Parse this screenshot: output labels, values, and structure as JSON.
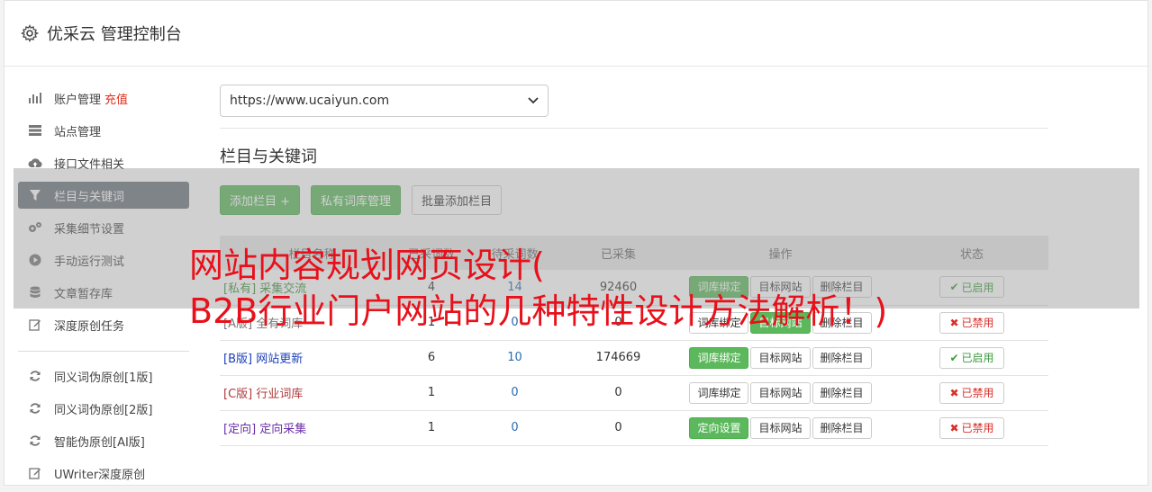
{
  "header": {
    "title": "优采云 管理控制台"
  },
  "sidebar": {
    "items": [
      {
        "label": "账户管理",
        "extra": "充值",
        "icon": "bar-chart-icon"
      },
      {
        "label": "站点管理",
        "icon": "server-icon"
      },
      {
        "label": "接口文件相关",
        "icon": "cloud-upload-icon"
      },
      {
        "label": "栏目与关键词",
        "icon": "filter-icon",
        "active": true
      },
      {
        "label": "采集细节设置",
        "icon": "gears-icon"
      },
      {
        "label": "手动运行测试",
        "icon": "play-icon"
      },
      {
        "label": "文章暂存库",
        "icon": "database-icon"
      },
      {
        "label": "深度原创任务",
        "icon": "edit-icon"
      }
    ],
    "items2": [
      {
        "label": "同义词伪原创[1版]",
        "icon": "refresh-icon"
      },
      {
        "label": "同义词伪原创[2版]",
        "icon": "refresh-icon"
      },
      {
        "label": "智能伪原创[AI版]",
        "icon": "refresh-icon"
      },
      {
        "label": "UWriter深度原创",
        "icon": "edit-icon"
      }
    ]
  },
  "main": {
    "site_select": "https://www.ucaiyun.com",
    "section_title": "栏目与关键词",
    "buttons": {
      "add_column": "添加栏目 +",
      "private_lib": "私有词库管理",
      "batch_add": "批量添加栏目"
    },
    "table": {
      "headers": [
        "栏目名称",
        "已采词数",
        "待采词数",
        "已采集",
        "操作",
        "状态"
      ],
      "rows": [
        {
          "tag": "[私有]",
          "name": "采集交流",
          "a": "4",
          "b": "14",
          "c": "92460",
          "op1": "词库绑定",
          "op2": "目标网站",
          "op3": "删除栏目",
          "status": "已启用"
        },
        {
          "tag": "[A版]",
          "name": "全有词库",
          "a": "1",
          "b": "0",
          "c": "0",
          "op1": "词库绑定",
          "op2": "目标网站",
          "op3": "删除栏目",
          "status": "已禁用"
        },
        {
          "tag": "[B版]",
          "name": "网站更新",
          "a": "6",
          "b": "10",
          "c": "174669",
          "op1": "词库绑定",
          "op2": "目标网站",
          "op3": "删除栏目",
          "status": "已启用"
        },
        {
          "tag": "[C版]",
          "name": "行业词库",
          "a": "1",
          "b": "0",
          "c": "0",
          "op1": "词库绑定",
          "op2": "目标网站",
          "op3": "删除栏目",
          "status": "已禁用"
        },
        {
          "tag": "[定向]",
          "name": "定向采集",
          "a": "1",
          "b": "0",
          "c": "0",
          "op1": "定向设置",
          "op2": "目标网站",
          "op3": "删除栏目",
          "status": "已禁用"
        }
      ]
    }
  },
  "overlay": {
    "line1": "网站内容规划网页设计(",
    "line2": "B2B行业门户网站的几种特性设计方法解析！)"
  },
  "colors": {
    "accent_green": "#5cb85c",
    "active_sidebar": "#6c757d",
    "headline_red": "#e8101a"
  }
}
